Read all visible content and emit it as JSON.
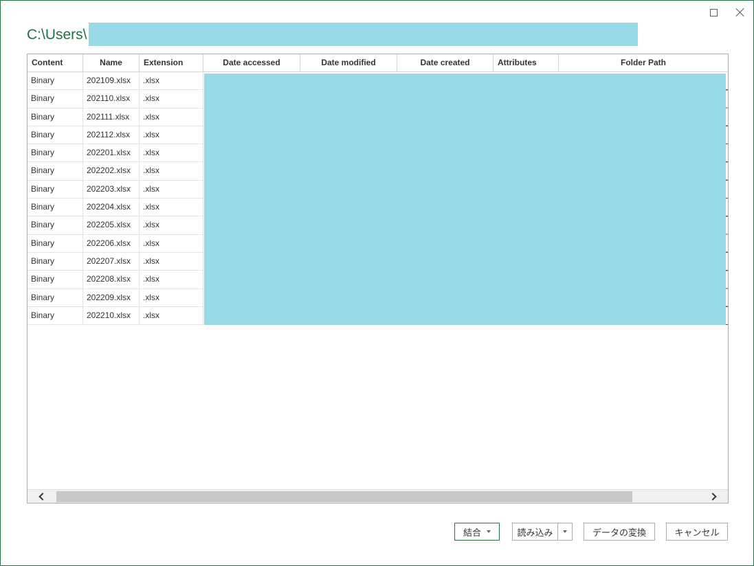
{
  "window": {
    "path_title": "C:\\Users\\"
  },
  "table": {
    "columns": [
      "Content",
      "Name",
      "Extension",
      "Date accessed",
      "Date modified",
      "Date created",
      "Attributes",
      "Folder Path"
    ],
    "rows": [
      {
        "content": "Binary",
        "name": "202109.xlsx",
        "extension": ".xlsx"
      },
      {
        "content": "Binary",
        "name": "202110.xlsx",
        "extension": ".xlsx"
      },
      {
        "content": "Binary",
        "name": "202111.xlsx",
        "extension": ".xlsx"
      },
      {
        "content": "Binary",
        "name": "202112.xlsx",
        "extension": ".xlsx"
      },
      {
        "content": "Binary",
        "name": "202201.xlsx",
        "extension": ".xlsx"
      },
      {
        "content": "Binary",
        "name": "202202.xlsx",
        "extension": ".xlsx"
      },
      {
        "content": "Binary",
        "name": "202203.xlsx",
        "extension": ".xlsx"
      },
      {
        "content": "Binary",
        "name": "202204.xlsx",
        "extension": ".xlsx"
      },
      {
        "content": "Binary",
        "name": "202205.xlsx",
        "extension": ".xlsx"
      },
      {
        "content": "Binary",
        "name": "202206.xlsx",
        "extension": ".xlsx"
      },
      {
        "content": "Binary",
        "name": "202207.xlsx",
        "extension": ".xlsx"
      },
      {
        "content": "Binary",
        "name": "202208.xlsx",
        "extension": ".xlsx"
      },
      {
        "content": "Binary",
        "name": "202209.xlsx",
        "extension": ".xlsx"
      },
      {
        "content": "Binary",
        "name": "202210.xlsx",
        "extension": ".xlsx"
      }
    ]
  },
  "footer": {
    "combine_label": "結合",
    "load_label": "読み込み",
    "transform_label": "データの変換",
    "cancel_label": "キャンセル"
  },
  "colors": {
    "accent": "#217346",
    "redaction": "#99d9e8"
  },
  "icons": {
    "maximize": "maximize-icon",
    "close": "close-icon",
    "scroll_left": "chevron-left-icon",
    "scroll_right": "chevron-right-icon",
    "dropdown": "chevron-down-icon"
  }
}
